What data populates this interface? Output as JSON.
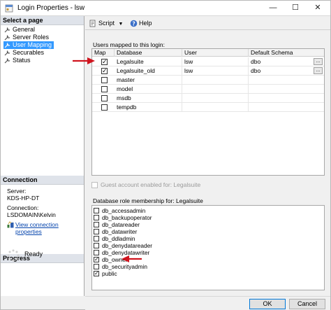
{
  "window": {
    "title": "Login Properties - lsw",
    "minimize": "—",
    "maximize": "☐",
    "close": "✕"
  },
  "left": {
    "select_header": "Select a page",
    "pages": [
      {
        "label": "General"
      },
      {
        "label": "Server Roles"
      },
      {
        "label": "User Mapping"
      },
      {
        "label": "Securables"
      },
      {
        "label": "Status"
      }
    ],
    "connection_header": "Connection",
    "server_label": "Server:",
    "server_value": "KDS-HP-DT",
    "connection_label": "Connection:",
    "connection_value": "LSDOMAIN\\Kelvin",
    "view_link": "View connection properties",
    "progress_header": "Progress",
    "progress_status": "Ready"
  },
  "toolbar": {
    "script": "Script",
    "help": "Help"
  },
  "mapping": {
    "label": "Users mapped to this login:",
    "columns": [
      "Map",
      "Database",
      "User",
      "Default Schema"
    ],
    "rows": [
      {
        "checked": true,
        "database": "Legalsuite",
        "user": "lsw",
        "schema": "dbo",
        "has_button": true
      },
      {
        "checked": true,
        "database": "Legalsuite_old",
        "user": "lsw",
        "schema": "dbo",
        "has_button": true
      },
      {
        "checked": false,
        "database": "master",
        "user": "",
        "schema": "",
        "has_button": false
      },
      {
        "checked": false,
        "database": "model",
        "user": "",
        "schema": "",
        "has_button": false
      },
      {
        "checked": false,
        "database": "msdb",
        "user": "",
        "schema": "",
        "has_button": false
      },
      {
        "checked": false,
        "database": "tempdb",
        "user": "",
        "schema": "",
        "has_button": false
      }
    ],
    "ellipsis": "..."
  },
  "guest_label": "Guest account enabled for: Legalsuite",
  "roles": {
    "label": "Database role membership for: Legalsuite",
    "items": [
      {
        "name": "db_accessadmin",
        "checked": false
      },
      {
        "name": "db_backupoperator",
        "checked": false
      },
      {
        "name": "db_datareader",
        "checked": false
      },
      {
        "name": "db_datawriter",
        "checked": false
      },
      {
        "name": "db_ddladmin",
        "checked": false
      },
      {
        "name": "db_denydatareader",
        "checked": false
      },
      {
        "name": "db_denydatawriter",
        "checked": false
      },
      {
        "name": "db_owner",
        "checked": true
      },
      {
        "name": "db_securityadmin",
        "checked": false
      },
      {
        "name": "public",
        "checked": true
      }
    ]
  },
  "buttons": {
    "ok": "OK",
    "cancel": "Cancel"
  },
  "colors": {
    "selection": "#3399ff",
    "arrow": "#d0141e",
    "link": "#0645ad"
  }
}
